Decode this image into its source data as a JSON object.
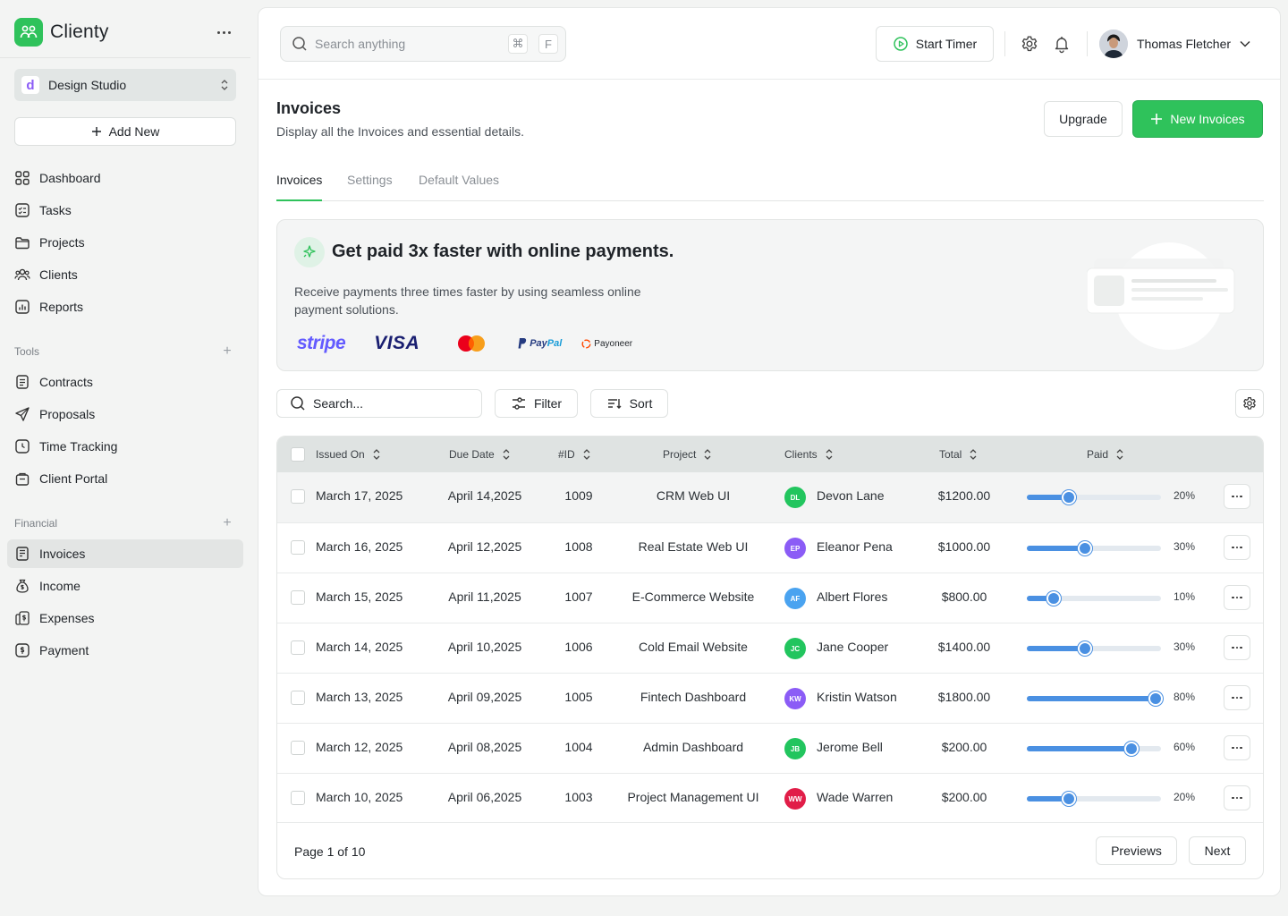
{
  "brand": {
    "name": "Clienty"
  },
  "workspace": {
    "initial": "d",
    "name": "Design Studio"
  },
  "add_new_label": "Add New",
  "nav_main": [
    {
      "label": "Dashboard",
      "icon": "dashboard-icon"
    },
    {
      "label": "Tasks",
      "icon": "tasks-icon"
    },
    {
      "label": "Projects",
      "icon": "folder-icon"
    },
    {
      "label": "Clients",
      "icon": "users-icon"
    },
    {
      "label": "Reports",
      "icon": "chart-icon"
    }
  ],
  "sections": {
    "tools": {
      "label": "Tools",
      "items": [
        "Contracts",
        "Proposals",
        "Time Tracking",
        "Client Portal"
      ]
    },
    "financial": {
      "label": "Financial",
      "items": [
        "Invoices",
        "Income",
        "Expenses",
        "Payment"
      ],
      "active": "Invoices"
    }
  },
  "topbar": {
    "search_placeholder": "Search anything",
    "shortcut_keys": [
      "⌘",
      "F"
    ],
    "timer_label": "Start Timer",
    "user_name": "Thomas Fletcher"
  },
  "page": {
    "title": "Invoices",
    "subtitle": "Display all the Invoices and essential details.",
    "upgrade_label": "Upgrade",
    "new_label": "New Invoices",
    "tabs": [
      "Invoices",
      "Settings",
      "Default Values"
    ],
    "active_tab": "Invoices"
  },
  "promo": {
    "title": "Get paid 3x faster with online payments.",
    "text": "Receive payments three times faster by using seamless online payment solutions.",
    "logos": {
      "stripe": "stripe",
      "visa": "VISA",
      "paypal_a": "Pay",
      "paypal_b": "Pal",
      "payoneer": "Payoneer"
    }
  },
  "toolbar": {
    "search_placeholder": "Search...",
    "filter_label": "Filter",
    "sort_label": "Sort"
  },
  "table": {
    "headers": [
      "Issued On",
      "Due Date",
      "#ID",
      "Project",
      "Clients",
      "Total",
      "Paid"
    ],
    "rows": [
      {
        "issued": "March 17, 2025",
        "due": "April 14,2025",
        "id": "1009",
        "project": "CRM Web UI",
        "initials": "DL",
        "client": "Devon Lane",
        "color": "#22c55e",
        "total": "$1200.00",
        "paid": 20,
        "paid_label": "20%"
      },
      {
        "issued": "March 16, 2025",
        "due": "April 12,2025",
        "id": "1008",
        "project": "Real Estate Web UI",
        "initials": "EP",
        "client": "Eleanor Pena",
        "color": "#8b5cf6",
        "total": "$1000.00",
        "paid": 30,
        "paid_label": "30%"
      },
      {
        "issued": "March 15, 2025",
        "due": "April 11,2025",
        "id": "1007",
        "project": "E-Commerce Website",
        "initials": "AF",
        "client": "Albert Flores",
        "color": "#4aa3f0",
        "total": "$800.00",
        "paid": 10,
        "paid_label": "10%"
      },
      {
        "issued": "March 14, 2025",
        "due": "April 10,2025",
        "id": "1006",
        "project": "Cold Email Website",
        "initials": "JC",
        "client": "Jane Cooper",
        "color": "#22c55e",
        "total": "$1400.00",
        "paid": 30,
        "paid_label": "30%"
      },
      {
        "issued": "March 13, 2025",
        "due": "April 09,2025",
        "id": "1005",
        "project": "Fintech Dashboard",
        "initials": "KW",
        "client": "Kristin Watson",
        "color": "#8b5cf6",
        "total": "$1800.00",
        "paid": 80,
        "paid_label": "80%"
      },
      {
        "issued": "March 12, 2025",
        "due": "April 08,2025",
        "id": "1004",
        "project": "Admin Dashboard",
        "initials": "JB",
        "client": "Jerome Bell",
        "color": "#22c55e",
        "total": "$200.00",
        "paid": 60,
        "paid_label": "60%"
      },
      {
        "issued": "March 10, 2025",
        "due": "April 06,2025",
        "id": "1003",
        "project": "Project Management UI",
        "initials": "WW",
        "client": "Wade Warren",
        "color": "#e11d48",
        "total": "$200.00",
        "paid": 20,
        "paid_label": "20%"
      }
    ]
  },
  "pagination": {
    "info": "Page 1 of 10",
    "prev_label": "Previews",
    "next_label": "Next"
  },
  "colors": {
    "accent": "#2fc25b",
    "progress": "#4a90e2"
  }
}
